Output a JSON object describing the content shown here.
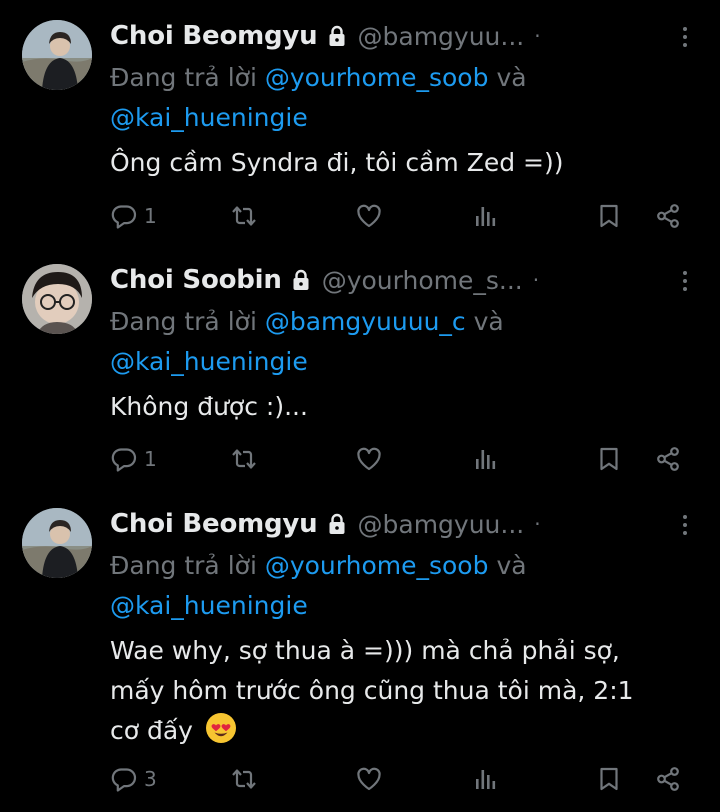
{
  "colors": {
    "background": "#000000",
    "primary_text": "#e7e9ea",
    "secondary_text": "#71767b",
    "mention": "#1d9bf0"
  },
  "replying_prefix": "Đang trả lời",
  "replying_conjunction": "và",
  "tweets": [
    {
      "name": "Choi Beomgyu",
      "protected_icon": "lock-icon",
      "handle": "@bamgyuu...",
      "separator": "·",
      "mention_1": "@yourhome_soob",
      "mention_2": "@kai_hueningie",
      "text": "Ông cầm Syndra đi, tôi cầm Zed =))",
      "reply_count": "1"
    },
    {
      "name": "Choi Soobin",
      "protected_icon": "lock-icon",
      "handle": "@yourhome_s...",
      "separator": "·",
      "mention_1": "@bamgyuuuu_c",
      "mention_2": "@kai_hueningie",
      "text": "Không được :)...",
      "reply_count": "1"
    },
    {
      "name": "Choi Beomgyu",
      "protected_icon": "lock-icon",
      "handle": "@bamgyuu...",
      "separator": "·",
      "mention_1": "@yourhome_soob",
      "mention_2": "@kai_hueningie",
      "text_line_1": "Wae why, sợ thua à =))) mà chả phải sợ,",
      "text_line_2": "mấy hôm trước ông cũng thua tôi mà, 2:1",
      "text_line_3": "cơ đấy",
      "emoji": "heart-eyes-emoji",
      "reply_count": "3"
    }
  ],
  "action_icons": [
    "reply-icon",
    "retweet-icon",
    "like-icon",
    "views-icon",
    "bookmark-icon",
    "share-icon"
  ]
}
